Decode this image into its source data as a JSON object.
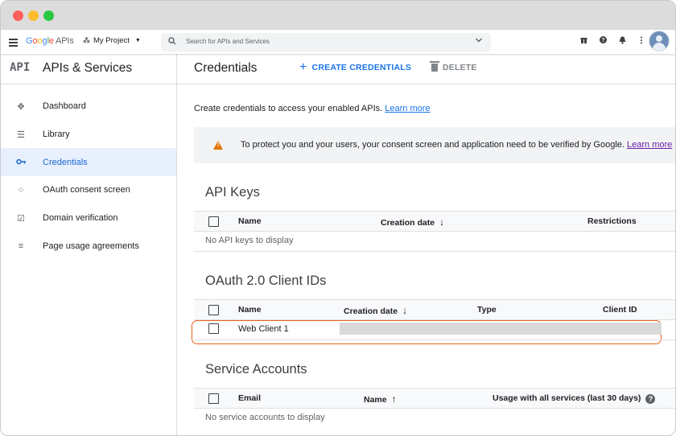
{
  "window_controls": [
    "close",
    "minimize",
    "maximize"
  ],
  "topbar": {
    "logo_google": "Google",
    "logo_apis": "APIs",
    "project_label": "My Project",
    "search_placeholder": "Search for APIs and Services",
    "icons": [
      "gift-icon",
      "help-icon",
      "bell-icon",
      "more-vert-icon"
    ]
  },
  "sidebar": {
    "logo": "API",
    "title": "APIs & Services",
    "items": [
      {
        "label": "Dashboard",
        "icon": "dashboard-icon",
        "active": false
      },
      {
        "label": "Library",
        "icon": "library-icon",
        "active": false
      },
      {
        "label": "Credentials",
        "icon": "key-icon",
        "active": true
      },
      {
        "label": "OAuth consent screen",
        "icon": "consent-icon",
        "active": false
      },
      {
        "label": "Domain verification",
        "icon": "checkbox-icon",
        "active": false
      },
      {
        "label": "Page usage agreements",
        "icon": "settings-list-icon",
        "active": false
      }
    ]
  },
  "header": {
    "title": "Credentials",
    "create_label": "CREATE CREDENTIALS",
    "delete_label": "DELETE"
  },
  "main": {
    "intro_text": "Create credentials to access your enabled APIs.",
    "intro_link": "Learn more",
    "warning_text": "To protect you and your users, your consent screen and application need to be verified by Google.",
    "warning_link": "Learn more",
    "api_keys": {
      "title": "API Keys",
      "columns": [
        "Name",
        "Creation date",
        "Restrictions"
      ],
      "empty_text": "No API keys to display"
    },
    "oauth": {
      "title": "OAuth 2.0 Client IDs",
      "columns": [
        "Name",
        "Creation date",
        "Type",
        "Client ID"
      ],
      "rows": [
        {
          "name": "Web Client 1"
        }
      ]
    },
    "service_accounts": {
      "title": "Service Accounts",
      "columns": [
        "Email",
        "Name",
        "Usage with all services (last 30 days)"
      ],
      "empty_text": "No service accounts to display"
    }
  },
  "colors": {
    "accent": "#1a73e8",
    "active_bg": "#e8f0fe",
    "warning": "#e37400",
    "highlight": "#e8611d"
  }
}
